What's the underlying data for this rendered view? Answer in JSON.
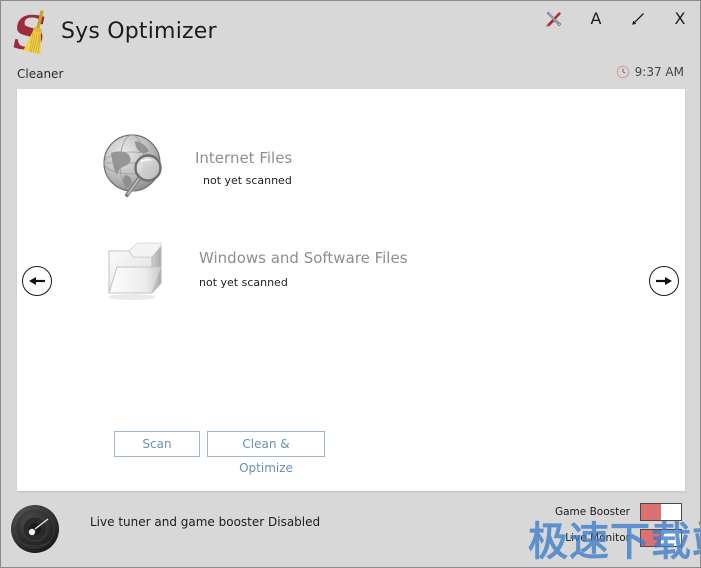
{
  "window": {
    "title": "Sys Optimizer",
    "logo_icon": "broom-s-logo-icon",
    "controls": [
      {
        "name": "tools-icon",
        "label": "⚒"
      },
      {
        "name": "font-size-icon",
        "label": "A"
      },
      {
        "name": "minimize-icon",
        "label": "╱"
      },
      {
        "name": "close-icon",
        "label": "X"
      }
    ]
  },
  "subheader": {
    "breadcrumb": "Cleaner",
    "clock_icon": "clock-icon",
    "time": "9:37 AM"
  },
  "main": {
    "items": [
      {
        "icon": "globe-search-icon",
        "title": "Internet Files",
        "status": "not yet scanned"
      },
      {
        "icon": "folder-icon",
        "title": "Windows and Software Files",
        "status": "not yet scanned"
      }
    ],
    "buttons": {
      "scan": "Scan",
      "clean": "Clean & Optimize"
    },
    "nav": {
      "prev_icon": "arrow-left-icon",
      "next_icon": "arrow-right-icon"
    }
  },
  "footer": {
    "gauge_icon": "speedometer-icon",
    "status": "Live tuner and game booster Disabled",
    "toggles": [
      {
        "label": "Game Booster",
        "state": "off"
      },
      {
        "label": "Live Monitor",
        "state": "off"
      }
    ]
  },
  "watermark": {
    "text": "极速下载站"
  },
  "colors": {
    "accent_red": "#dd7070",
    "button_blue": "#6d90b0",
    "title_gray": "#8e8e8e",
    "chrome_gray": "#d8d8d8",
    "watermark_blue": "#3b7bc9"
  }
}
